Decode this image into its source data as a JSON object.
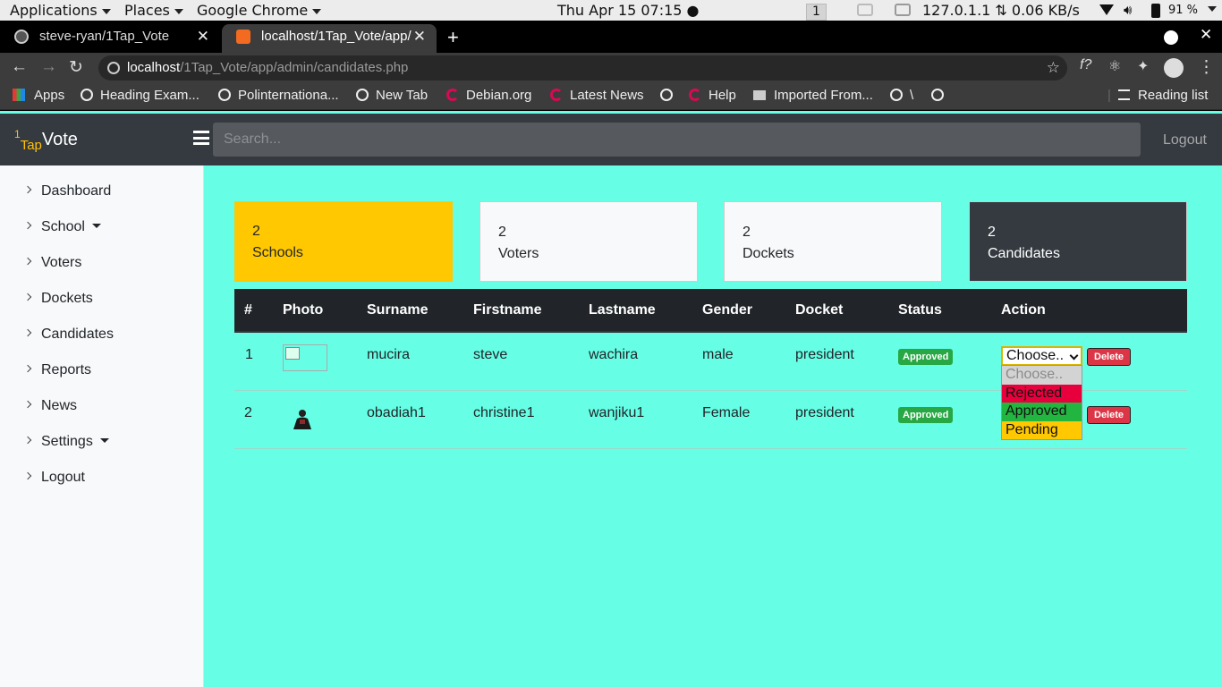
{
  "os_bar": {
    "applications": "Applications",
    "places": "Places",
    "active_app": "Google Chrome",
    "clock": "Thu Apr 15  07:15 ●",
    "workspace": "1",
    "net_stats": "127.0.1.1 ⇅ 0.06 KB/s",
    "battery": "91 %"
  },
  "browser": {
    "tabs": [
      {
        "title": "steve-ryan/1Tap_Vote",
        "active": false
      },
      {
        "title": "localhost/1Tap_Vote/app/",
        "active": true
      }
    ],
    "url_host": "localhost",
    "url_path": "/1Tap_Vote/app/admin/candidates.php",
    "bookmarks": [
      "Apps",
      "Heading Exam...",
      "Polinternationa...",
      "New Tab",
      "Debian.org",
      "Latest News",
      "Help",
      "Imported From...",
      "\\",
      "Reading list"
    ]
  },
  "app": {
    "brand_sup": "1",
    "brand_sub": "Tap",
    "brand_main": "Vote",
    "search_placeholder": "Search...",
    "logout": "Logout",
    "sidebar": [
      "Dashboard",
      "School",
      "Voters",
      "Dockets",
      "Candidates",
      "Reports",
      "News",
      "Settings",
      "Logout"
    ],
    "cards": [
      {
        "count": "2",
        "label": "Schools",
        "bg": "#ffc800",
        "color": "#212529"
      },
      {
        "count": "2",
        "label": "Voters",
        "bg": "#f8f9fa",
        "color": "#212529"
      },
      {
        "count": "2",
        "label": "Dockets",
        "bg": "#f8f9fa",
        "color": "#212529"
      },
      {
        "count": "2",
        "label": "Candidates",
        "bg": "#343a40",
        "color": "#ffffff"
      }
    ],
    "table": {
      "headers": [
        "#",
        "Photo",
        "Surname",
        "Firstname",
        "Lastname",
        "Gender",
        "Docket",
        "Status",
        "Action"
      ],
      "rows": [
        {
          "n": "1",
          "surname": "mucira",
          "firstname": "steve",
          "lastname": "wachira",
          "gender": "male",
          "docket": "president",
          "status": "Approved",
          "delete": "Delete"
        },
        {
          "n": "2",
          "surname": "obadiah1",
          "firstname": "christine1",
          "lastname": "wanjiku1",
          "gender": "Female",
          "docket": "president",
          "status": "Approved",
          "delete": "Delete"
        }
      ]
    },
    "status_select": {
      "value": "Choose..",
      "options": [
        {
          "label": "Choose..",
          "bg": "#d3d3d3",
          "color": "#8a8a8a"
        },
        {
          "label": "Rejected",
          "bg": "#e8003d",
          "color": "#111111"
        },
        {
          "label": "Approved",
          "bg": "#22b53f",
          "color": "#111111"
        },
        {
          "label": "Pending",
          "bg": "#ffc800",
          "color": "#111111"
        }
      ]
    }
  }
}
